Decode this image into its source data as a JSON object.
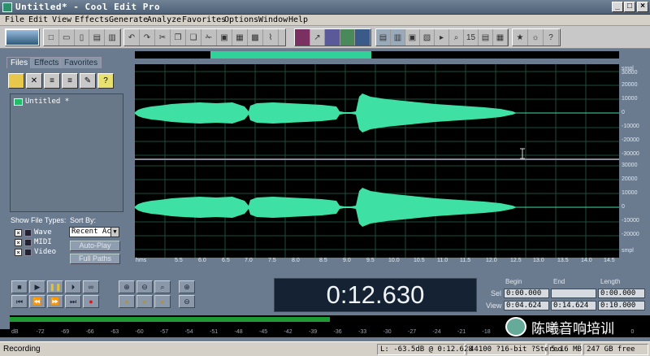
{
  "window": {
    "title": "Untitled* - Cool Edit Pro"
  },
  "menu": [
    "File",
    "Edit",
    "View",
    "Effects",
    "Generate",
    "Analyze",
    "Favorites",
    "Options",
    "Window",
    "Help"
  ],
  "panel": {
    "tabs": [
      "Files",
      "Effects",
      "Favorites"
    ],
    "files": [
      "Untitled *"
    ],
    "show_file_types_label": "Show File Types:",
    "sort_by_label": "Sort By:",
    "file_types": [
      "Wave",
      "MIDI",
      "Video"
    ],
    "sort_value": "Recent Acc",
    "auto_play": "Auto-Play",
    "full_paths": "Full Paths"
  },
  "ruler_right": {
    "units": "smpl",
    "top_ticks": [
      "30000",
      "20000",
      "10000",
      "0",
      "-10000",
      "-20000",
      "-30000"
    ],
    "bottom_ticks": [
      "30000",
      "20000",
      "10000",
      "0",
      "-10000",
      "-20000"
    ],
    "bottom_units": "smpl"
  },
  "time_ruler": {
    "start_label": "hms",
    "end_label": "hms",
    "ticks": [
      "5.5",
      "6.0",
      "6.5",
      "7.0",
      "7.5",
      "8.0",
      "8.5",
      "9.0",
      "9.5",
      "10.0",
      "10.5",
      "11.0",
      "11.5",
      "12.0",
      "12.5",
      "13.0",
      "13.5",
      "14.0",
      "14.5"
    ]
  },
  "transport": {
    "time": "0:12.630"
  },
  "selection": {
    "headers": [
      "Begin",
      "End",
      "Length"
    ],
    "sel_label": "Sel",
    "view_label": "View",
    "sel_begin": "0:00.000",
    "sel_end": "",
    "sel_length": "0:00.000",
    "view_begin": "0:04.624",
    "view_end": "0:14.624",
    "view_length": "0:10.000"
  },
  "meter": {
    "level": 0.5,
    "ticks": [
      "dB",
      "-72",
      "-69",
      "-66",
      "-63",
      "-60",
      "-57",
      "-54",
      "-51",
      "-48",
      "-45",
      "-42",
      "-39",
      "-36",
      "-33",
      "-30",
      "-27",
      "-24",
      "-21",
      "-18",
      "-15",
      "-12",
      "-9",
      "-6",
      "-3",
      "0"
    ]
  },
  "watermark": "陈曦音响培训",
  "status": {
    "state": "Recording",
    "level": "L: -63.5dB @  0:12.628",
    "format": "44100 ?16-bit ?Stereo",
    "size": "5.16 MB",
    "free": "247 GB free"
  },
  "colors": {
    "wave": "#3ee0a4",
    "background": "#000000",
    "panel": "#6b7b8f"
  }
}
